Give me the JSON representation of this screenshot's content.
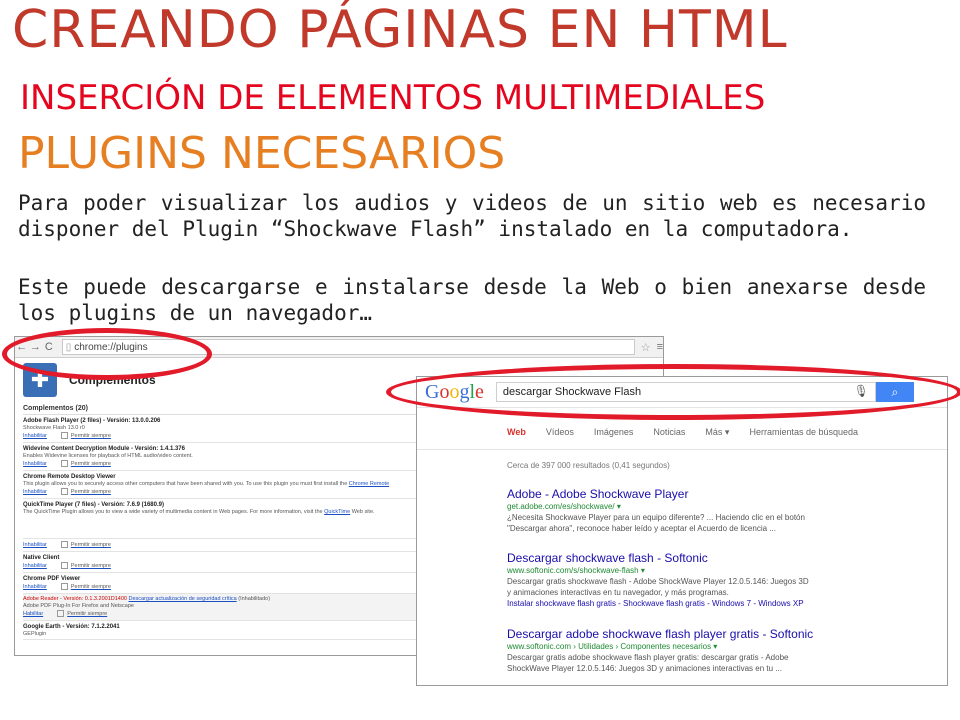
{
  "slide": {
    "title": "CREANDO PÁGINAS EN HTML",
    "subtitle": "INSERCIÓN DE ELEMENTOS MULTIMEDIALES",
    "heading": "PLUGINS NECESARIOS",
    "paragraph1": "Para poder visualizar los audios y videos de un sitio web es necesario disponer del Plugin “Shockwave Flash” instalado en la computadora.",
    "paragraph2": "Este puede descargarse e instalarse desde la Web o bien anexarse desde los plugins de un navegador…"
  },
  "chrome": {
    "address": "chrome://plugins",
    "page_title": "Complementos",
    "count": "Complementos (20)",
    "items": [
      {
        "name": "Adobe Flash Player (2 files) - Versión: 13.0.0.206",
        "desc": "Shockwave Flash 13.0 r0",
        "action": "Inhabilitar",
        "always": "Permitir siempre"
      },
      {
        "name": "Widevine Content Decryption Module - Versión: 1.4.1.376",
        "desc": "Enables Widevine licenses for playback of HTML audio/video content.",
        "action": "Inhabilitar",
        "always": "Permitir siempre"
      },
      {
        "name": "Chrome Remote Desktop Viewer",
        "desc": "This plugin allows you to securely access other computers that have been shared with you. To use this plugin you must first install the",
        "link": "Chrome Remote",
        "action": "Inhabilitar",
        "always": "Permitir siempre"
      },
      {
        "name": "QuickTime Player (7 files) - Versión: 7.6.9 (1680.9)",
        "desc": "The QuickTime Plugin allows you to view a wide variety of multimedia content in Web pages. For more information, visit the",
        "link": "QuickTime",
        "desc_end": "Web site.",
        "action": "Inhabilitar",
        "always": "Permitir siempre"
      },
      {
        "name": "Native Client",
        "desc": "",
        "action": "Inhabilitar",
        "always": "Permitir siempre"
      },
      {
        "name": "Chrome PDF Viewer",
        "desc": "",
        "action": "Inhabilitar",
        "always": "Permitir siempre"
      },
      {
        "name": "Adobe Reader - Versión: 0.1.3.2001D1400",
        "link": "Descargar actualización de seguridad crítica",
        "state": "(Inhabilitado)",
        "desc": "Adobe PDF Plug-In For Firefox and Netscape",
        "action": "Habilitar",
        "always": "Permitir siempre"
      },
      {
        "name": "Google Earth - Versión: 7.1.2.2041",
        "desc": "GEPlugin"
      }
    ]
  },
  "google": {
    "logo": "Google",
    "query": "descargar Shockwave Flash",
    "tabs": [
      "Web",
      "Vídeos",
      "Imágenes",
      "Noticias",
      "Más ▾",
      "Herramientas de búsqueda"
    ],
    "results_count": "Cerca de 397 000 resultados (0,41 segundos)",
    "results": [
      {
        "title": "Adobe - Adobe Shockwave Player",
        "url": "get.adobe.com/es/shockwave/ ▾",
        "desc1": "¿Necesita Shockwave Player para un equipo diferente? ... Haciendo clic en el botón",
        "desc2": "\"Descargar ahora\", reconoce haber leído y aceptar el Acuerdo de licencia ..."
      },
      {
        "title": "Descargar shockwave flash - Softonic",
        "url": "www.softonic.com/s/shockwave-flash ▾",
        "desc1": "Descargar gratis shockwave flash - Adobe ShockWave Player 12.0.5.146: Juegos 3D",
        "desc2": "y animaciones interactivas en tu navegador, y más programas.",
        "sub": "Instalar shockwave flash gratis - Shockwave flash gratis - Windows 7 - Windows XP"
      },
      {
        "title": "Descargar adobe shockwave flash player gratis - Softonic",
        "url": "www.softonic.com › Utilidades › Componentes necesarios ▾",
        "desc1": "Descargar gratis adobe shockwave flash player gratis: descargar gratis - Adobe",
        "desc2": "ShockWave Player 12.0.5.146: Juegos 3D y animaciones interactivas en tu ..."
      }
    ]
  },
  "colors": {
    "title": "#c0392b",
    "subtitle": "#e4051e",
    "heading": "#e67e22",
    "highlight": "#e21b2b"
  }
}
